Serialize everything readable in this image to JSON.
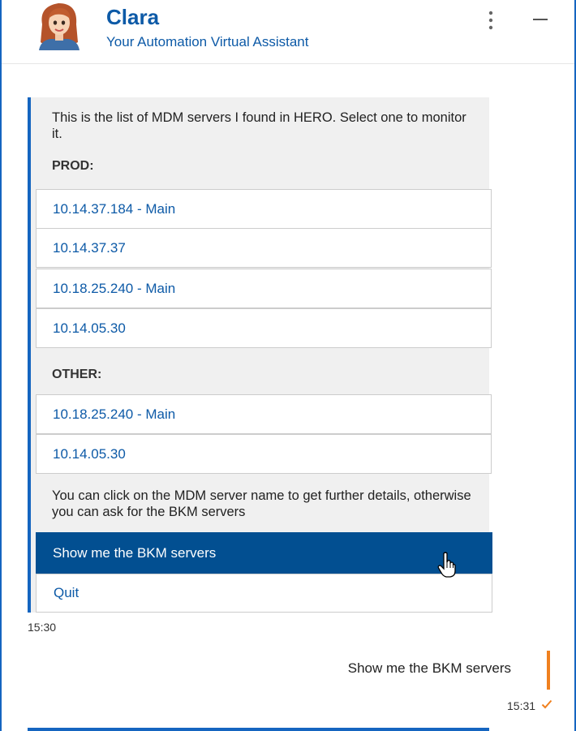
{
  "header": {
    "title": "Clara",
    "subtitle": "Your Automation Virtual Assistant",
    "avatar_icon": "assistant-avatar-icon",
    "menu_icon": "more-vertical-icon",
    "minimize_icon": "minimize-icon"
  },
  "bot_message": {
    "intro": "This is the list of MDM servers I found in HERO. Select one to monitor it.",
    "groups": [
      {
        "label": "PROD:",
        "servers": [
          "10.14.37.184 - Main",
          "10.14.37.37",
          "10.18.25.240 - Main",
          "10.14.05.30"
        ]
      },
      {
        "label": "OTHER:",
        "servers": [
          "10.18.25.240 - Main",
          "10.14.05.30"
        ]
      }
    ],
    "closing": "You can click on the MDM server name to get further details, otherwise you can ask for the BKM servers",
    "actions": {
      "bkm": "Show me the BKM servers",
      "quit": "Quit"
    },
    "time": "15:30"
  },
  "user_message": {
    "text": "Show me the BKM servers",
    "time": "15:31",
    "status_icon": "check-icon"
  },
  "colors": {
    "brand_blue": "#0d5aa7",
    "accent_border": "#1565c0",
    "action_button": "#024f91",
    "user_accent": "#f0801e",
    "card_bg": "#f0f0f0"
  }
}
